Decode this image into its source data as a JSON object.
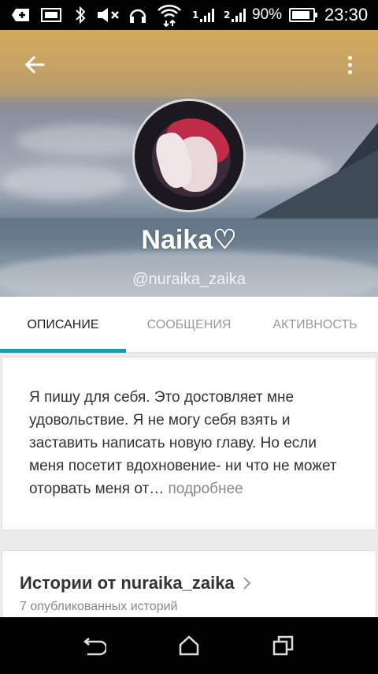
{
  "status_bar": {
    "battery_percent": "90%",
    "time": "23:30",
    "icons": [
      "usb-debug-icon",
      "sd-card-icon",
      "bluetooth-icon",
      "mute-icon",
      "headset-icon",
      "wifi-icon",
      "signal-1-icon",
      "signal-2-icon",
      "battery-icon"
    ],
    "signal_1_label": "1",
    "signal_2_label": "2"
  },
  "header": {
    "back_icon": "arrow-left-icon",
    "menu_icon": "more-vertical-icon",
    "name": "Naika♡",
    "handle": "@nuraika_zaika"
  },
  "tabs": [
    {
      "label": "ОПИСАНИЕ",
      "active": true
    },
    {
      "label": "СООБЩЕНИЯ",
      "active": false
    },
    {
      "label": "АКТИВНОСТЬ",
      "active": false
    }
  ],
  "description": {
    "text": "Я пишу для себя. Это достовляет мне удовольствие. Я не могу себя взять и заставить написать новую главу. Но если меня посетит вдохновение- ни что не может оторвать меня от…",
    "more_label": " подробнее"
  },
  "stories": {
    "title": "Истории от nuraika_zaika",
    "subtitle": "7 опубликованных историй"
  },
  "colors": {
    "accent": "#1d9aa8",
    "header_gold": "#c9a561"
  }
}
